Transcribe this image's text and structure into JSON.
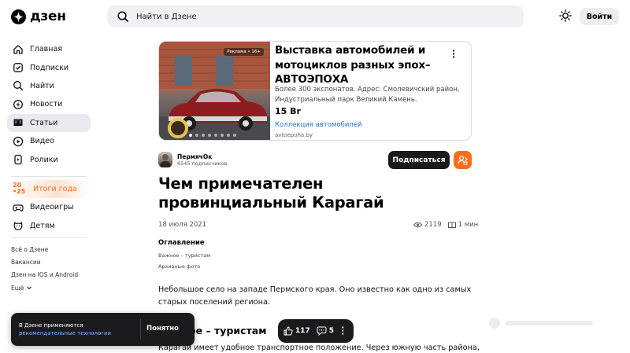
{
  "header": {
    "logo_text": "дзен",
    "search_placeholder": "Найти в Дзене",
    "login_label": "Войти"
  },
  "sidebar": {
    "items": [
      {
        "label": "Главная",
        "icon": "home-icon"
      },
      {
        "label": "Подписки",
        "icon": "subscriptions-icon"
      },
      {
        "label": "Найти",
        "icon": "search-icon"
      },
      {
        "label": "Новости",
        "icon": "news-icon"
      },
      {
        "label": "Статьи",
        "icon": "articles-icon",
        "active": true
      },
      {
        "label": "Видео",
        "icon": "video-icon"
      },
      {
        "label": "Ролики",
        "icon": "shorts-icon"
      }
    ],
    "year_badge_top": "20",
    "year_badge_bottom": "•25",
    "year_label": "Итоги года",
    "extra_items": [
      {
        "label": "Видеоигры",
        "icon": "gamepad-icon"
      },
      {
        "label": "Детям",
        "icon": "kids-icon"
      }
    ],
    "links": [
      "Всё о Дзене",
      "Вакансии",
      "Дзен на IOS и Android",
      "Ещё"
    ]
  },
  "ad": {
    "badge": "Реклама • 16+",
    "title": "Выставка автомобилей и мотоциклов разных эпох–АВТОЭПОХА",
    "description": "Более 300 экспонатов. Адрес: Смолевичский район, Индустриальный парк Великий Камень.",
    "price": "15 Br",
    "link": "Коллекция автомобилей",
    "domain": "avtoepoha.by",
    "slides_total": 8,
    "slide_active": 1
  },
  "author": {
    "name": "ПермячОк",
    "subscribers": "6545 подписчиков",
    "subscribe_label": "Подписаться"
  },
  "article": {
    "title": "Чем примечателен провинциальный Карагай",
    "date": "18 июля 2021",
    "views": "2119",
    "read_time": "1 мин",
    "toc_heading": "Оглавление",
    "toc": [
      "Важное – туристам",
      "Архивные фото"
    ],
    "paragraph1": "Небольшое село на западе Пермского края. Оно известно как одно из самых старых поселений региона.",
    "heading2": "Важное – туристам",
    "paragraph2": "Карагай имеет удобное транспортное положение. Через южную часть района,"
  },
  "cookie": {
    "text": "В Дзене применяются",
    "link": "рекомендательные технологии",
    "button": "Понятно"
  },
  "reactions": {
    "likes": "117",
    "comments": "5"
  },
  "colors": {
    "accent": "#ff6b1e",
    "link": "#2b6dc8",
    "dark": "#1b1b1e"
  }
}
